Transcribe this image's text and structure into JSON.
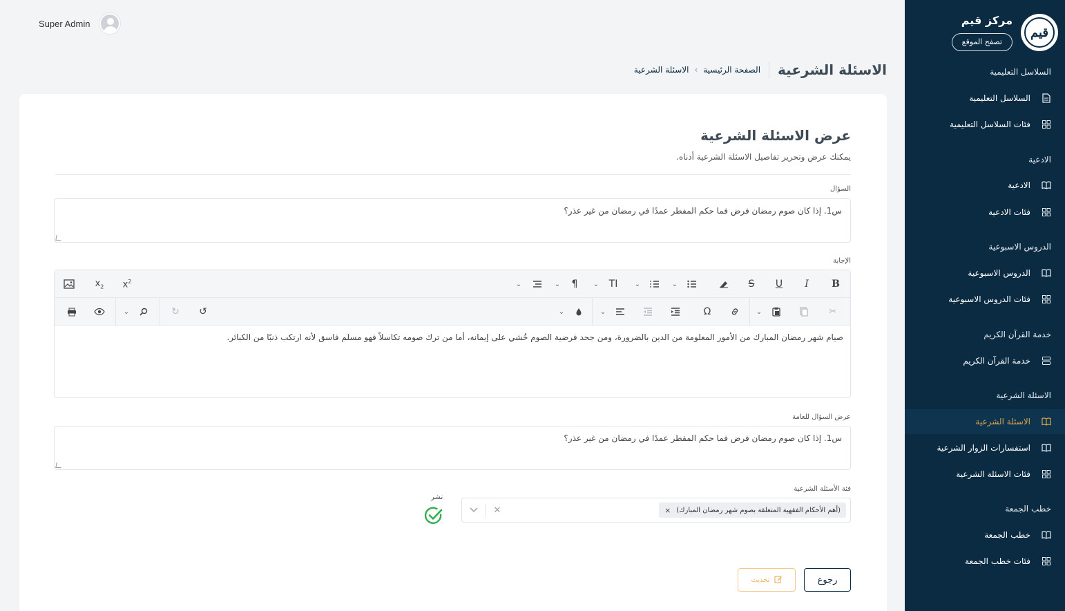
{
  "sidebar": {
    "brand_title": "مركز قيم",
    "brand_logo_text": "قيم",
    "site_button": "تصفح الموقع",
    "sections": [
      {
        "title": "السلاسل التعليمية",
        "items": [
          {
            "label": "السلاسل التعليمية",
            "icon": "document-icon"
          },
          {
            "label": "فئات السلاسل التعليمية",
            "icon": "grid-icon"
          }
        ]
      },
      {
        "title": "الادعية",
        "items": [
          {
            "label": "الادعية",
            "icon": "book-icon"
          },
          {
            "label": "فئات الادعية",
            "icon": "grid-icon"
          }
        ]
      },
      {
        "title": "الدروس الاسبوعية",
        "items": [
          {
            "label": "الدروس الاسبوعية",
            "icon": "book-icon"
          },
          {
            "label": "فئات الدروس الاسبوعية",
            "icon": "grid-icon"
          }
        ]
      },
      {
        "title": "خدمة القرآن الكريم",
        "items": [
          {
            "label": "خدمة القرآن الكريم",
            "icon": "server-icon"
          }
        ]
      },
      {
        "title": "الاسئلة الشرعية",
        "items": [
          {
            "label": "الاسئلة الشرعية",
            "icon": "book-icon",
            "active": true
          },
          {
            "label": "استفسارات الزوار الشرعية",
            "icon": "book-icon"
          },
          {
            "label": "فئات الاسئلة الشرعية",
            "icon": "grid-icon"
          }
        ]
      },
      {
        "title": "خطب الجمعة",
        "items": [
          {
            "label": "خطب الجمعة",
            "icon": "book-icon"
          },
          {
            "label": "فئات خطب الجمعة",
            "icon": "grid-icon"
          }
        ]
      }
    ],
    "active_color": "#d7a44a",
    "background_color": "#0b2b42"
  },
  "topbar": {
    "user_name": "Super Admin"
  },
  "header": {
    "title": "الاسئلة الشرعية",
    "breadcrumb_home": "الصفحة الرئيسية",
    "breadcrumb_sep": "›",
    "breadcrumb_current": "الاسئلة الشرعية"
  },
  "card": {
    "title": "عرض الاسئلة الشرعية",
    "subtitle": "يمكنك عرض وتحرير تفاصيل الاسئلة الشرعية أدناه.",
    "question_label": "السؤال",
    "question_value": "س1. إذا كان صوم رمضان فرض  فما حكم المفطر عمدًا في رمضان من غير عذر؟",
    "answer_label": "الإجابة",
    "answer_value": "صيام شهر رمضان المبارك من الأمور المعلومة من الدين بالضرورة، ومن جحد فرضية الصوم خُشي على إيمانه، أما من ترك صومه تكاسلاً فهو مسلم فاسق لأنه ارتكب ذنبًا من الكبائر.",
    "public_question_label": "عرض السؤال للعامة",
    "public_question_value": "س1. إذا كان صوم رمضان فرض  فما حكم المفطر عمدًا في رمضان من غير عذر؟",
    "category_label": "فئة الأسئلة الشرعية",
    "category_selected": "(أهم الأحكام الفقهية المتعلقة بصوم شهر رمضان المبارك)",
    "publish_label": "نشر",
    "publish_checked": true,
    "back_button": "رجوع",
    "update_button": "تحديث"
  },
  "editor_toolbar": {
    "row1": [
      "image-icon",
      "subscript-icon",
      "superscript-icon",
      "align-dropdown-icon",
      "paragraph-icon",
      "font-size-icon",
      "ordered-list-icon",
      "unordered-list-icon",
      "eraser-icon",
      "strikethrough-icon",
      "underline-icon",
      "italic-icon",
      "bold-icon"
    ],
    "row2": [
      "print-icon",
      "preview-icon",
      "find-icon",
      "redo-icon",
      "undo-icon",
      "color-icon",
      "align-left-icon",
      "outdent-icon",
      "indent-icon",
      "special-char-icon",
      "link-icon",
      "paste-icon",
      "copy-icon",
      "cut-icon"
    ]
  }
}
